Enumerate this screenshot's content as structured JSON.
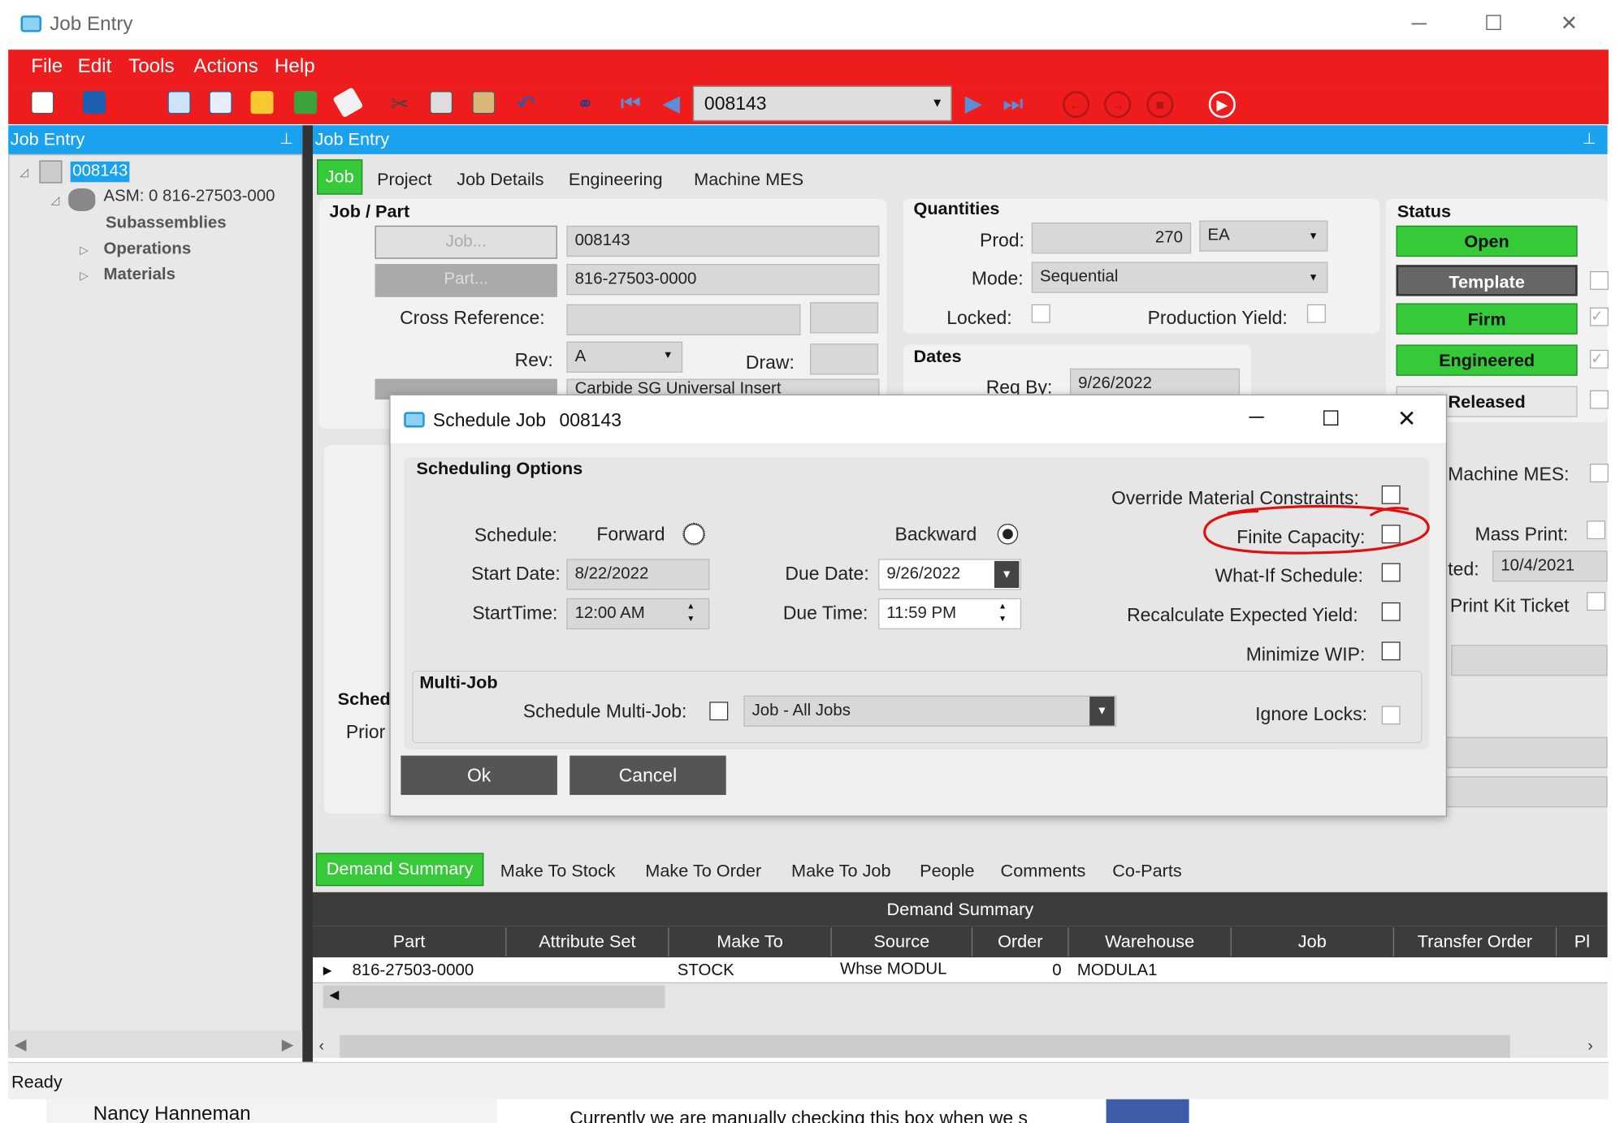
{
  "window": {
    "title": "Job Entry"
  },
  "menu": [
    "File",
    "Edit",
    "Tools",
    "Actions",
    "Help"
  ],
  "toolbar": {
    "record": "008143"
  },
  "left": {
    "header": "Job Entry",
    "tree": {
      "root": "008143",
      "asm": "ASM: 0 816-27503-000",
      "sub": "Subassemblies",
      "ops": "Operations",
      "mats": "Materials"
    }
  },
  "right": {
    "header": "Job Entry",
    "tabs": [
      "Job",
      "Project",
      "Job Details",
      "Engineering",
      "Machine MES"
    ],
    "jobpart": {
      "section": "Job / Part",
      "job_btn": "Job...",
      "part_btn": "Part...",
      "job": "008143",
      "part": "816-27503-0000",
      "xref_label": "Cross Reference:",
      "rev_label": "Rev:",
      "rev": "A",
      "draw_label": "Draw:",
      "desc": "Carbide SG Universal Insert"
    },
    "quantities": {
      "section": "Quantities",
      "prod_label": "Prod:",
      "prod": "270",
      "uom": "EA",
      "mode_label": "Mode:",
      "mode": "Sequential",
      "locked_label": "Locked:",
      "yield_label": "Production Yield:"
    },
    "dates": {
      "section": "Dates",
      "req_label": "Req By:",
      "req": "9/26/2022"
    },
    "status": {
      "section": "Status",
      "open": "Open",
      "template": "Template",
      "firm": "Firm",
      "engineered": "Engineered",
      "released": "Released",
      "mes_label": "Machine MES:",
      "mass_label": "Mass Print:",
      "ted_label": "ted:",
      "ted": "10/4/2021",
      "kit_label": "Print Kit Ticket"
    },
    "sched_partial": {
      "sched": "Sched",
      "prior": "Prior"
    }
  },
  "dialog": {
    "title": "Schedule Job",
    "job": "008143",
    "section": "Scheduling Options",
    "schedule_label": "Schedule:",
    "forward": "Forward",
    "backward": "Backward",
    "start_date_label": "Start Date:",
    "start_date": "8/22/2022",
    "start_time_label": "StartTime:",
    "start_time": "12:00 AM",
    "due_date_label": "Due Date:",
    "due_date": "9/26/2022",
    "due_time_label": "Due Time:",
    "due_time": "11:59 PM",
    "override": "Override Material Constraints:",
    "finite": "Finite Capacity:",
    "whatif": "What-If Schedule:",
    "recalc": "Recalculate Expected Yield:",
    "minwip": "Minimize WIP:",
    "multijob": {
      "section": "Multi-Job",
      "label": "Schedule Multi-Job:",
      "select": "Job - All Jobs",
      "ignore": "Ignore Locks:"
    },
    "ok": "Ok",
    "cancel": "Cancel"
  },
  "bottom": {
    "tabs": [
      "Demand Summary",
      "Make To Stock",
      "Make To Order",
      "Make To Job",
      "People",
      "Comments",
      "Co-Parts"
    ],
    "grid_title": "Demand Summary",
    "columns": [
      "Part",
      "Attribute Set",
      "Make To",
      "Source",
      "Order",
      "Warehouse",
      "Job",
      "Transfer Order",
      "Pl"
    ],
    "row": {
      "part": "816-27503-0000",
      "attr": "",
      "make_to": "STOCK",
      "source": "Whse MODUL",
      "order": "0",
      "warehouse": "MODULA1"
    }
  },
  "status": "Ready",
  "behind": {
    "name": "Nancy Hanneman",
    "text": "Currently we are manually checking this box when we s"
  },
  "colors": {
    "accent": "#1aa2ee",
    "menubar": "#ee1c1c",
    "green": "#36c93a",
    "annotation": "#e01010"
  }
}
